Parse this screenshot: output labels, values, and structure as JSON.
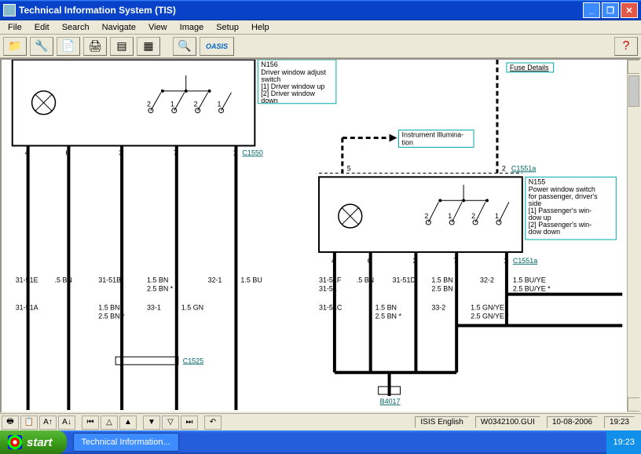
{
  "window": {
    "title": "Technical Information System (TIS)"
  },
  "menu": {
    "file": "File",
    "edit": "Edit",
    "search": "Search",
    "navigate": "Navigate",
    "view": "View",
    "image": "Image",
    "setup": "Setup",
    "help": "Help"
  },
  "toolbar": {
    "oasis": "OASIS"
  },
  "diagram": {
    "box_n156": {
      "id": "N156",
      "l1": "Driver window adjust",
      "l2": "switch",
      "l3": "[1] Driver window up",
      "l4": "[2] Driver window",
      "l5": "down"
    },
    "box_n155": {
      "id": "N155",
      "l1": "Power window switch",
      "l2": "for passenger, driver's",
      "l3": "side",
      "l4": "[1] Passenger's win-",
      "l5": "dow up",
      "l6": "[2] Passenger's win-",
      "l7": "dow down"
    },
    "fuse_details": "Fuse Details",
    "instr_illum": {
      "l1": "Instrument Illumina-",
      "l2": "tion"
    },
    "conn": {
      "c1550": "C1550",
      "c1525": "C1525",
      "c1551a_top": "C1551a",
      "c1551a": "C1551a",
      "b4017": "B4017"
    },
    "left_pins": {
      "p4": "4",
      "p6": "6",
      "p3": "3",
      "p7": "7",
      "p1": "1"
    },
    "right_pins_top": {
      "p5": "5",
      "p2": "2"
    },
    "right_pins_mid": {
      "sw2a": "2",
      "sw1a": "1",
      "sw2b": "2",
      "sw1b": "1"
    },
    "right_pins_bot": {
      "p4": "4",
      "p6": "6",
      "p3": "3",
      "p7": "7",
      "p1": "1"
    },
    "left_wires": {
      "r1": {
        "a": "31-51E",
        "b": ".5 BN",
        "c": "31-51B",
        "d": "1.5 BN",
        "e": "32-1",
        "f": "1.5 BU"
      },
      "r1b": {
        "d": "2.5 BN *"
      },
      "r2": {
        "a": "31-51A",
        "c": "1.5 BN",
        "d": "33-1",
        "e": "1.5 GN"
      },
      "r2b": {
        "c": "2.5 BN *"
      }
    },
    "right_wires": {
      "r1": {
        "a": "31-51F",
        "b": ".5 BN",
        "c": "31-51D",
        "d": "1.5 BN",
        "e": "32-2",
        "f": "1.5 BU/YE"
      },
      "r1b": {
        "a": "31-51",
        "d": "2.5 BN *",
        "f": "2.5 BU/YE *"
      },
      "r2": {
        "a": "31-51C",
        "b": "1.5 BN",
        "d": "33-2",
        "e": "1.5 GN/YE"
      },
      "r2b": {
        "b": "2.5 BN *",
        "e": "2.5 GN/YE *"
      }
    }
  },
  "status": {
    "lang": "ISIS English",
    "file": "W0342100.GUI",
    "date": "10-08-2006",
    "time": "19:23"
  },
  "taskbar": {
    "start": "start",
    "task1": "Technical Information...",
    "clock": "19:23"
  }
}
